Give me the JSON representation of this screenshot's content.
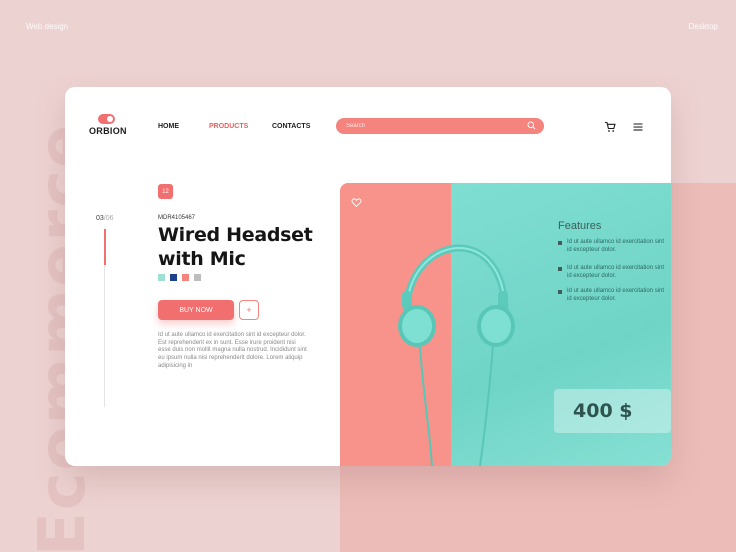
{
  "corner_labels": {
    "left": "Web design",
    "right": "Desktop"
  },
  "background_word": "Ecommerce",
  "logo": {
    "text": "ORBION"
  },
  "nav": [
    {
      "label": "HOME",
      "active": false
    },
    {
      "label": "PRODUCTS",
      "active": true
    },
    {
      "label": "CONTACTS",
      "active": false
    }
  ],
  "search": {
    "placeholder": "Search",
    "value": ""
  },
  "icons": {
    "cart": "cart-icon",
    "menu": "menu-icon",
    "search": "search-icon",
    "favorite": "heart-icon"
  },
  "slider": {
    "current": "03",
    "total": "/06",
    "progress": 0.2
  },
  "product": {
    "tag": "12",
    "sku": "MDR4105467",
    "title": "Wired Headset with Mic",
    "colors": [
      "#9ee0d2",
      "#1e3f8a",
      "#f5837e",
      "#bdbdbd"
    ],
    "buy_label": "BUY NOW",
    "plus_label": "+",
    "description": "Id ut aute ullamco id exercitation sint id excepteur dolor. Est reprehenderit ex in sunt. Esse irure proident nisi esse duis non mollit magna nulla nostrud. Incididunt sint eu ipsum nulla nisi reprehenderit dolore. Lorem aliquip adipisicing in"
  },
  "features": {
    "title": "Features",
    "items": [
      "Id ut aute ullamco id exercitation sint id excepteur dolor.",
      "Id ut aute ullamco id exercitation sint id excepteur dolor.",
      "Id ut aute ullamco id exercitation sint id excepteur dolor."
    ]
  },
  "price": "400 $",
  "colors": {
    "accent": "#f26f6f",
    "teal": "#78dace",
    "pink": "#f8938b",
    "background": "#ecd2d1"
  }
}
